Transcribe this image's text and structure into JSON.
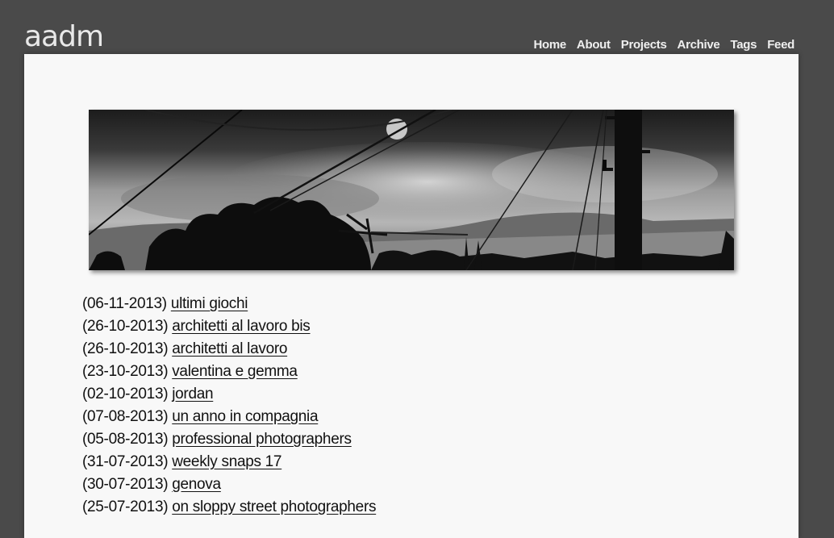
{
  "site": {
    "title": "aadm"
  },
  "nav": {
    "items": [
      {
        "label": "Home"
      },
      {
        "label": "About"
      },
      {
        "label": "Projects"
      },
      {
        "label": "Archive"
      },
      {
        "label": "Tags"
      },
      {
        "label": "Feed"
      }
    ]
  },
  "banner": {
    "icon": "landscape-photo-bw"
  },
  "posts": [
    {
      "date": "(06-11-2013)",
      "title": "ultimi giochi"
    },
    {
      "date": "(26-10-2013)",
      "title": "architetti al lavoro bis"
    },
    {
      "date": "(26-10-2013)",
      "title": "architetti al lavoro"
    },
    {
      "date": "(23-10-2013)",
      "title": "valentina e gemma"
    },
    {
      "date": "(02-10-2013)",
      "title": "jordan"
    },
    {
      "date": "(07-08-2013)",
      "title": "un anno in compagnia"
    },
    {
      "date": "(05-08-2013)",
      "title": "professional photographers"
    },
    {
      "date": "(31-07-2013)",
      "title": "weekly snaps 17"
    },
    {
      "date": "(30-07-2013)",
      "title": "genova"
    },
    {
      "date": "(25-07-2013)",
      "title": "on sloppy street photographers"
    }
  ]
}
